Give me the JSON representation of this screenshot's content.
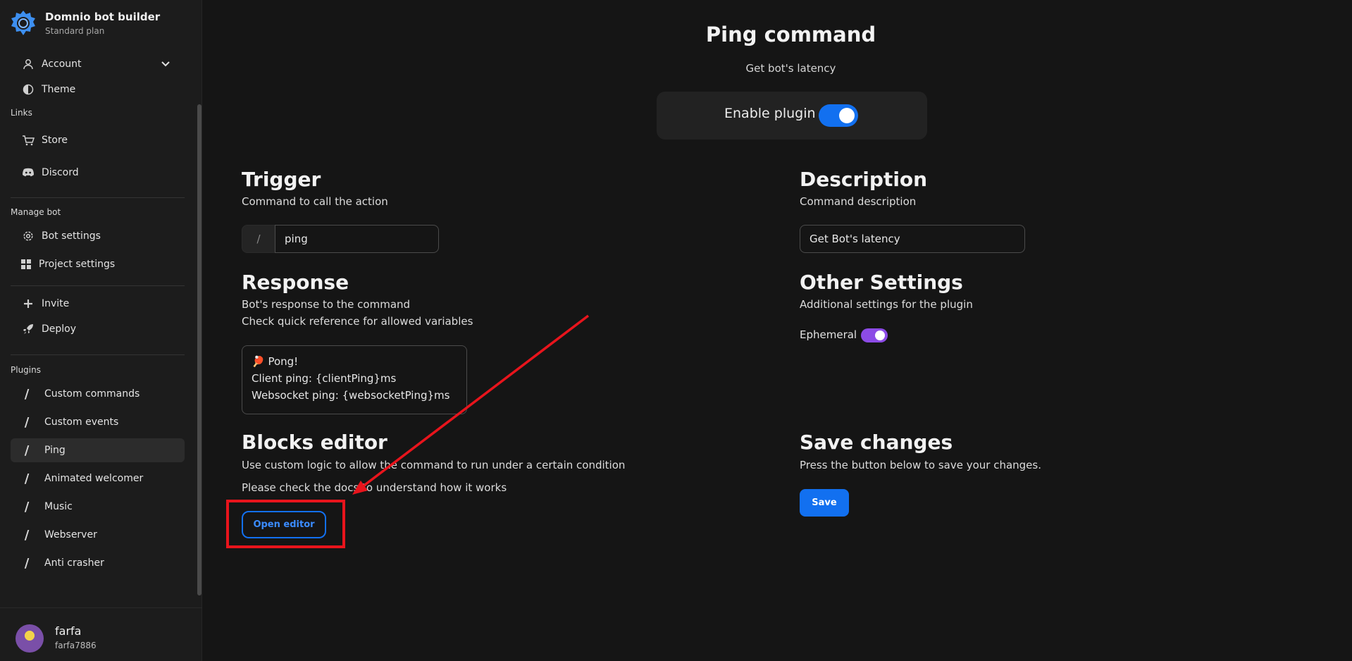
{
  "brand": {
    "title": "Domnio bot builder",
    "plan": "Standard plan"
  },
  "sidebar": {
    "top_items": [
      {
        "label": "Account",
        "icon": "user-icon"
      },
      {
        "label": "Theme",
        "icon": "half-circle-icon"
      }
    ],
    "links_title": "Links",
    "links": [
      {
        "label": "Store",
        "icon": "cart-icon"
      },
      {
        "label": "Discord",
        "icon": "discord-icon"
      }
    ],
    "manage_title": "Manage bot",
    "manage": [
      {
        "label": "Bot settings",
        "icon": "gear-icon"
      },
      {
        "label": "Project settings",
        "icon": "grid-icon"
      }
    ],
    "actions": [
      {
        "label": "Invite",
        "icon": "plus-icon"
      },
      {
        "label": "Deploy",
        "icon": "rocket-icon"
      }
    ],
    "plugins_title": "Plugins",
    "plugins": [
      {
        "label": "Custom commands"
      },
      {
        "label": "Custom events"
      },
      {
        "label": "Ping",
        "active": true
      },
      {
        "label": "Animated welcomer"
      },
      {
        "label": "Music"
      },
      {
        "label": "Webserver"
      },
      {
        "label": "Anti crasher"
      }
    ]
  },
  "user": {
    "name": "farfa",
    "tag": "farfa7886"
  },
  "main": {
    "title": "Ping command",
    "subtitle": "Get bot's latency",
    "enable_label": "Enable plugin",
    "enable_on": true,
    "trigger": {
      "title": "Trigger",
      "desc": "Command to call the action",
      "prefix": "/",
      "value": "ping"
    },
    "description": {
      "title": "Description",
      "desc": "Command description",
      "value": "Get Bot's latency"
    },
    "response": {
      "title": "Response",
      "desc1": "Bot's response to the command",
      "desc2": "Check quick reference for allowed variables",
      "line1": "🏓 Pong!",
      "line2": "Client ping: {clientPing}ms",
      "line3": "Websocket ping: {websocketPing}ms"
    },
    "other": {
      "title": "Other Settings",
      "desc": "Additional settings for the plugin",
      "ephemeral_label": "Ephemeral",
      "ephemeral_on": true
    },
    "blocks": {
      "title": "Blocks editor",
      "desc1": "Use custom logic to allow the command to run under a certain condition",
      "desc2": "Please check the docs to understand how it works",
      "button": "Open editor"
    },
    "save": {
      "title": "Save changes",
      "desc": "Press the button below to save your changes.",
      "button": "Save"
    }
  },
  "colors": {
    "accent": "#1270f0",
    "toggle_purple": "#8c4be6",
    "annotation_red": "#e8141c"
  }
}
